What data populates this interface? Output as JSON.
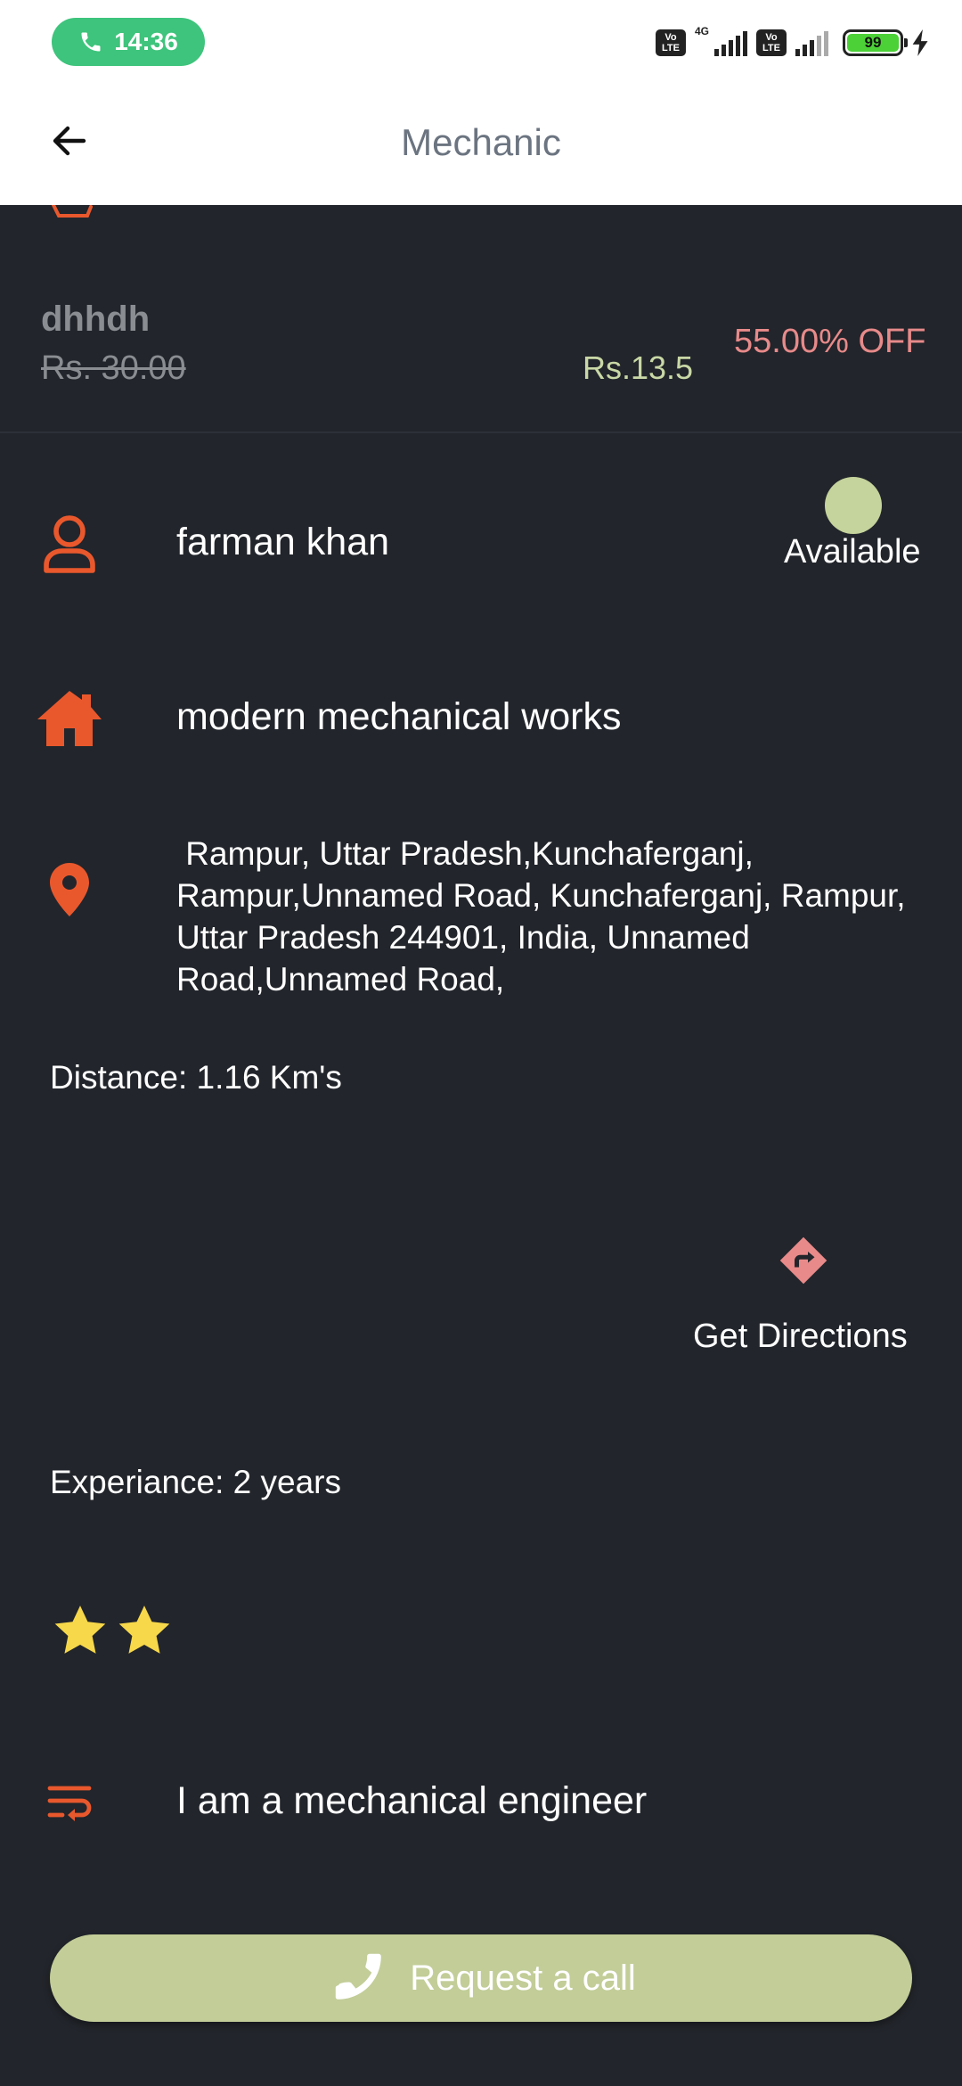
{
  "status_bar": {
    "time": "14:36",
    "network_label": "4G",
    "volte_label": "Vo LTE",
    "battery": "99"
  },
  "app_bar": {
    "title": "Mechanic"
  },
  "offer": {
    "name": "dhhdh",
    "original_price": "Rs. 30.00",
    "discounted_price": "Rs.13.5",
    "discount": "55.00% OFF"
  },
  "mechanic": {
    "name": "farman khan",
    "availability": "Available",
    "shop_name": "modern mechanical works",
    "address": " Rampur, Uttar Pradesh,Kunchaferganj,\nRampur,Unnamed Road, Kunchaferganj, Rampur,\nUttar Pradesh 244901, India, Unnamed\nRoad,Unnamed Road,",
    "distance": "Distance: 1.16 Km's",
    "directions_label": "Get Directions",
    "experience": "Experiance: 2 years",
    "rating": 2,
    "description": "I am a mechanical engineer"
  },
  "actions": {
    "request_call_label": "Request a call"
  },
  "colors": {
    "background": "#22252b",
    "accent_orange": "#e9582d",
    "available_green": "#c5d39c",
    "discount_pink": "#e88a8a",
    "star_yellow": "#f7d84a",
    "button_green": "#c2cd98"
  },
  "icons": {
    "call": "phone-icon",
    "back": "arrow-left-icon",
    "person": "person-icon",
    "home": "home-icon",
    "location": "location-pin-icon",
    "directions": "directions-icon",
    "star": "star-icon",
    "description": "wrap-text-icon"
  }
}
